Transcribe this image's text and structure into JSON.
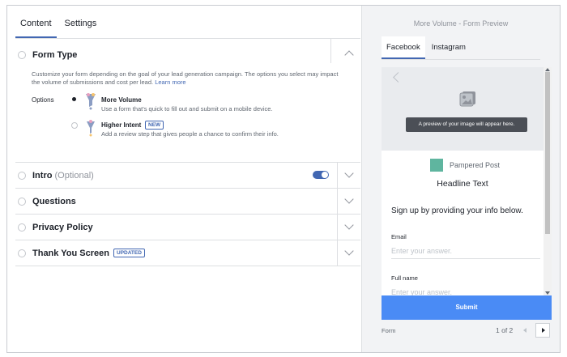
{
  "tabs": [
    {
      "label": "Content",
      "active": true
    },
    {
      "label": "Settings",
      "active": false
    }
  ],
  "form_type": {
    "title": "Form Type",
    "description": "Customize your form depending on the goal of your lead generation campaign. The options you select may impact the volume of submissions and cost per lead.",
    "learn_more": "Learn more",
    "options_label": "Options",
    "options": [
      {
        "title": "More Volume",
        "subtitle": "Use a form that's quick to fill out and submit on a mobile device.",
        "selected": true
      },
      {
        "title": "Higher Intent",
        "badge": "NEW",
        "subtitle": "Add a review step that gives people a chance to confirm their info.",
        "selected": false
      }
    ]
  },
  "sections": [
    {
      "title": "Intro",
      "optional": "(Optional)",
      "toggle_on": true
    },
    {
      "title": "Questions"
    },
    {
      "title": "Privacy Policy"
    },
    {
      "title": "Thank You Screen",
      "badge": "UPDATED"
    }
  ],
  "preview": {
    "title": "More Volume - Form Preview",
    "tabs": [
      {
        "label": "Facebook",
        "active": true
      },
      {
        "label": "Instagram",
        "active": false
      }
    ],
    "image_tooltip": "A preview of your image will appear here.",
    "brand_name": "Pampered Post",
    "brand_color": "#5fb59f",
    "headline": "Headline Text",
    "signup_text": "Sign up by providing your info below.",
    "fields": [
      {
        "label": "Email",
        "placeholder": "Enter your answer."
      },
      {
        "label": "Full name",
        "placeholder": "Enter your answer."
      }
    ],
    "submit_label": "Submit",
    "footer_label": "Form",
    "page_indicator": "1 of 2"
  },
  "colors": {
    "accent": "#4267b2",
    "submit": "#4a8bf5"
  }
}
